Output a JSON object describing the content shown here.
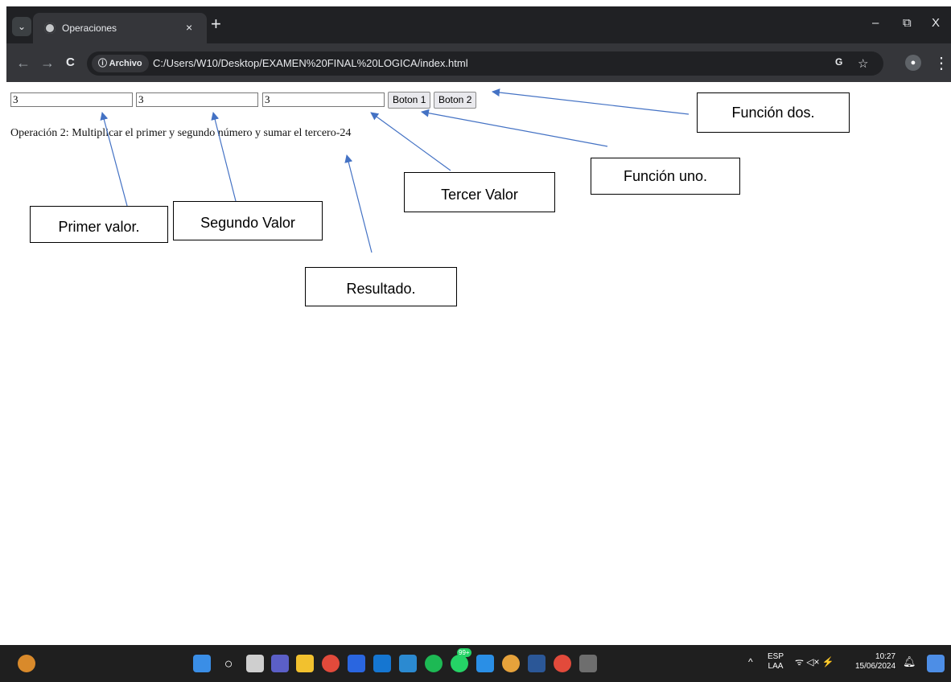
{
  "browser": {
    "tab_title": "Operaciones",
    "tab_close": "×",
    "new_tab": "+",
    "tab_list": "⌄",
    "back": "←",
    "forward": "→",
    "reload": "C",
    "security_chip": "ⓘ Archivo",
    "url": "C:/Users/W10/Desktop/EXAMEN%20FINAL%20LOGICA/index.html",
    "minimize": "–",
    "restore": "⧉",
    "close": "X",
    "translate_icon": "G",
    "bookmark_icon": "☆",
    "profile_icon": "●",
    "menu_icon": "⋮"
  },
  "page": {
    "input1_value": "3",
    "input2_value": "3",
    "input3_value": "3",
    "button1_label": "Boton 1",
    "button2_label": "Boton 2",
    "result_text": "Operación 2: Multiplicar el primer y segundo número y sumar el tercero-24"
  },
  "annotations": {
    "funcion_dos": "Función dos.",
    "funcion_uno": "Función uno.",
    "tercer_valor": "Tercer Valor",
    "primer_valor": "Primer valor.",
    "segundo_valor": "Segundo Valor",
    "resultado": "Resultado.",
    "arrow_color": "#4472c4"
  },
  "taskbar": {
    "language": "ESP",
    "region": "LAA",
    "time": "10:27",
    "date": "15/06/2024",
    "whatsapp_badge": "99+",
    "volume_icon": "ᯤ ◁× ⚡",
    "show_hidden_icon": "^"
  }
}
